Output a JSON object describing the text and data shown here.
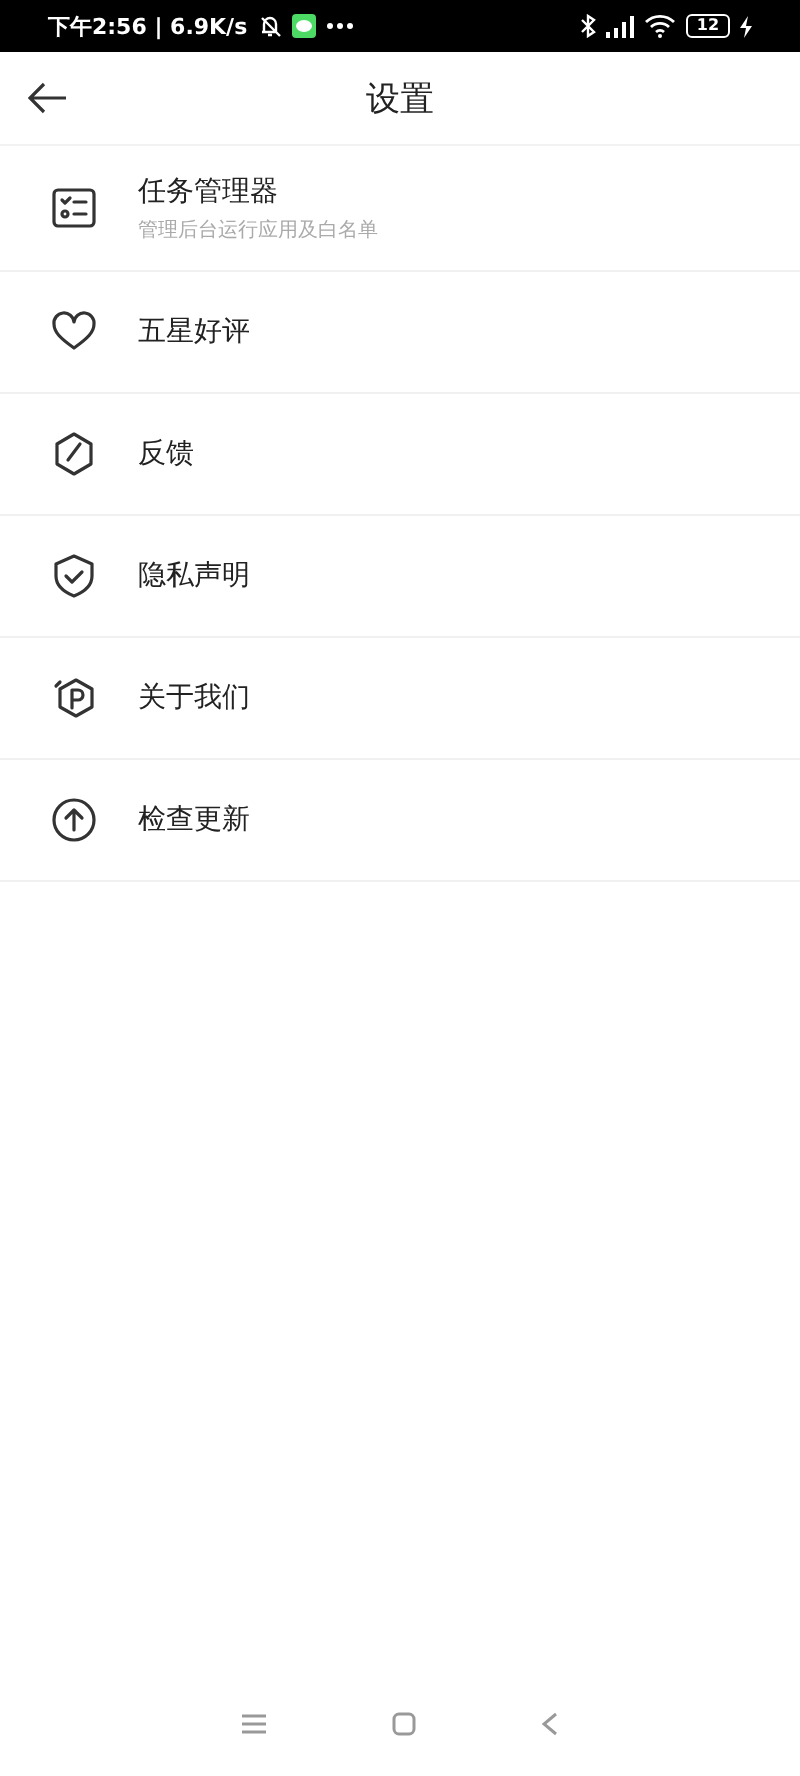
{
  "status_bar": {
    "time": "下午2:56 | 6.9K/s",
    "battery": "12"
  },
  "header": {
    "title": "设置"
  },
  "items": [
    {
      "kind": "tasks",
      "label": "任务管理器",
      "subtitle": "管理后台运行应用及白名单"
    },
    {
      "kind": "heart",
      "label": "五星好评"
    },
    {
      "kind": "pen",
      "label": "反馈"
    },
    {
      "kind": "shield",
      "label": "隐私声明"
    },
    {
      "kind": "about",
      "label": "关于我们"
    },
    {
      "kind": "update",
      "label": "检查更新"
    }
  ]
}
